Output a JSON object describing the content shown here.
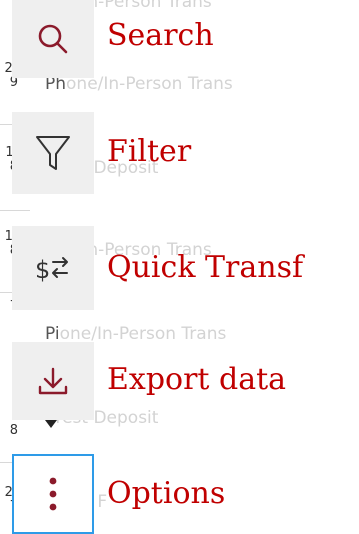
{
  "background": {
    "dates": [
      {
        "top": "2⁴",
        "bottom": "9"
      },
      {
        "top": "1:",
        "bottom": "8"
      },
      {
        "top": "1(",
        "bottom": "8"
      },
      {
        "top": "7",
        "bottom": ""
      },
      {
        "top": "",
        "bottom": "8"
      },
      {
        "top": "2(",
        "bottom": "7"
      }
    ],
    "rows": [
      {
        "dark": "",
        "faded": "one/In-Person Trans"
      },
      {
        "dark": "Ph",
        "faded": "one/In-Person Trans"
      },
      {
        "dark": "",
        "faded": "erest Deposit"
      },
      {
        "dark": "",
        "faded": "one/In-Person Trans"
      },
      {
        "dark": "Pi",
        "faded": "one/In-Person Trans"
      },
      {
        "dark": "",
        "faded": "erest Deposit"
      },
      {
        "dark": "",
        "faded": "livery F"
      }
    ]
  },
  "menu": {
    "items": [
      {
        "label": "Search",
        "icon": "search-icon"
      },
      {
        "label": "Filter",
        "icon": "filter-icon"
      },
      {
        "label": "Quick Transf",
        "icon": "quick-transfer-icon"
      },
      {
        "label": "Export data",
        "icon": "download-icon"
      },
      {
        "label": "Options",
        "icon": "more-vertical-icon"
      }
    ],
    "accent_color": "#c00000",
    "icon_color": "#8b1a2b",
    "focus_color": "#2e9be8"
  }
}
